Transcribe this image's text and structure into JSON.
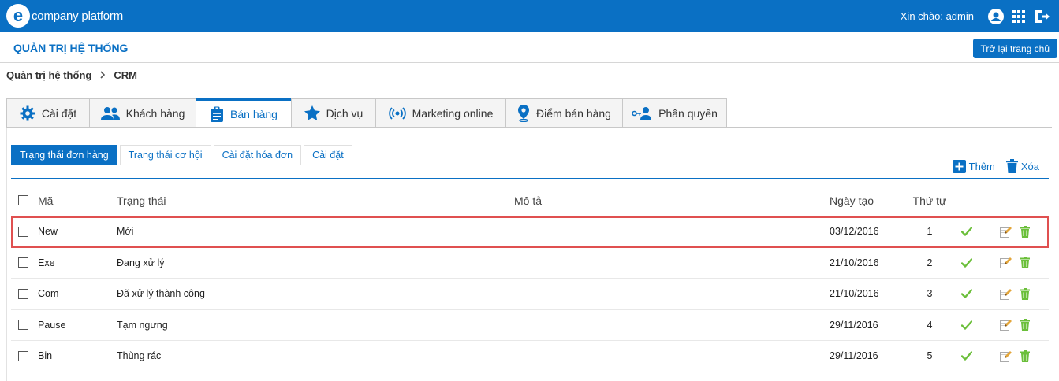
{
  "app": {
    "logo_letter": "e",
    "logo_text": "company platform",
    "greeting": "Xin chào: admin",
    "colors": {
      "primary": "#0a70c4",
      "check": "#6bbf3a",
      "delete": "#6bbf3a",
      "highlight": "#e05050"
    },
    "icons": {
      "user": "user-circle-icon",
      "apps": "grid-icon",
      "logout": "logout-icon"
    }
  },
  "admin": {
    "title": "QUẢN TRỊ HỆ THỐNG",
    "home_button": "Trở lại trang chủ"
  },
  "breadcrumb": {
    "root": "Quản trị hệ thống",
    "current": "CRM"
  },
  "tabs": [
    {
      "label": "Cài đặt",
      "icon": "gear-icon"
    },
    {
      "label": "Khách hàng",
      "icon": "users-icon"
    },
    {
      "label": "Bán hàng",
      "icon": "clipboard-icon",
      "active": true
    },
    {
      "label": "Dịch vụ",
      "icon": "star-icon"
    },
    {
      "label": "Marketing online",
      "icon": "broadcast-icon"
    },
    {
      "label": "Điểm bán hàng",
      "icon": "map-pin-icon"
    },
    {
      "label": "Phân quyền",
      "icon": "user-key-icon"
    }
  ],
  "subtabs": [
    {
      "label": "Trạng thái đơn hàng",
      "active": true
    },
    {
      "label": "Trạng thái cơ hội"
    },
    {
      "label": "Cài đặt hóa đơn"
    },
    {
      "label": "Cài đặt"
    }
  ],
  "actions": {
    "add": "Thêm",
    "delete": "Xóa"
  },
  "table": {
    "headers": {
      "code": "Mã",
      "status": "Trạng thái",
      "description": "Mô tả",
      "created": "Ngày tạo",
      "order": "Thứ tự"
    },
    "rows": [
      {
        "code": "New",
        "status": "Mới",
        "description": "",
        "created": "03/12/2016",
        "order": "1",
        "highlighted": true
      },
      {
        "code": "Exe",
        "status": "Đang xử lý",
        "description": "",
        "created": "21/10/2016",
        "order": "2"
      },
      {
        "code": "Com",
        "status": "Đã xử lý thành công",
        "description": "",
        "created": "21/10/2016",
        "order": "3"
      },
      {
        "code": "Pause",
        "status": "Tạm ngưng",
        "description": "",
        "created": "29/11/2016",
        "order": "4"
      },
      {
        "code": "Bin",
        "status": "Thùng rác",
        "description": "",
        "created": "29/11/2016",
        "order": "5"
      }
    ]
  }
}
